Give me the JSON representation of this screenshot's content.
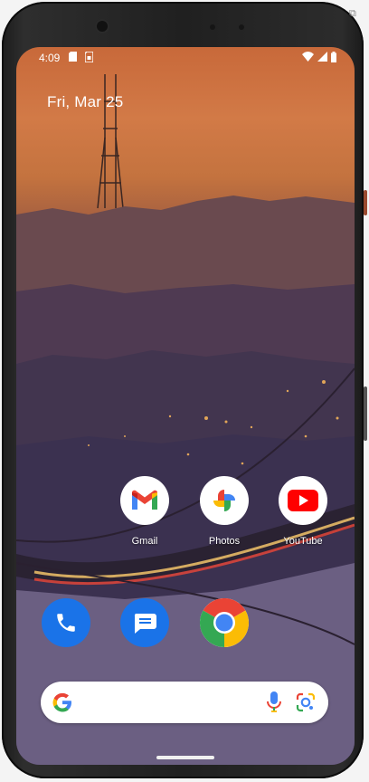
{
  "status_bar": {
    "time": "4:09",
    "left_icons": [
      "sd-card-icon",
      "sim-icon"
    ],
    "right_icons": [
      "wifi-icon",
      "signal-icon",
      "battery-icon"
    ]
  },
  "date_widget": {
    "text": "Fri, Mar 25"
  },
  "apps": [
    {
      "name": "Gmail",
      "icon": "gmail-icon"
    },
    {
      "name": "Photos",
      "icon": "photos-icon"
    },
    {
      "name": "YouTube",
      "icon": "youtube-icon"
    }
  ],
  "dock": [
    {
      "icon": "phone-icon",
      "color": "#1a73e8"
    },
    {
      "icon": "messages-icon",
      "color": "#1a73e8"
    },
    {
      "icon": "chrome-icon",
      "color": "#ffffff"
    }
  ],
  "search_bar": {
    "left_icon": "google-g-icon",
    "right_icons": [
      "microphone-icon",
      "google-lens-icon"
    ]
  },
  "colors": {
    "google_blue": "#4285F4",
    "google_red": "#EA4335",
    "google_yellow": "#FBBC05",
    "google_green": "#34A853"
  }
}
